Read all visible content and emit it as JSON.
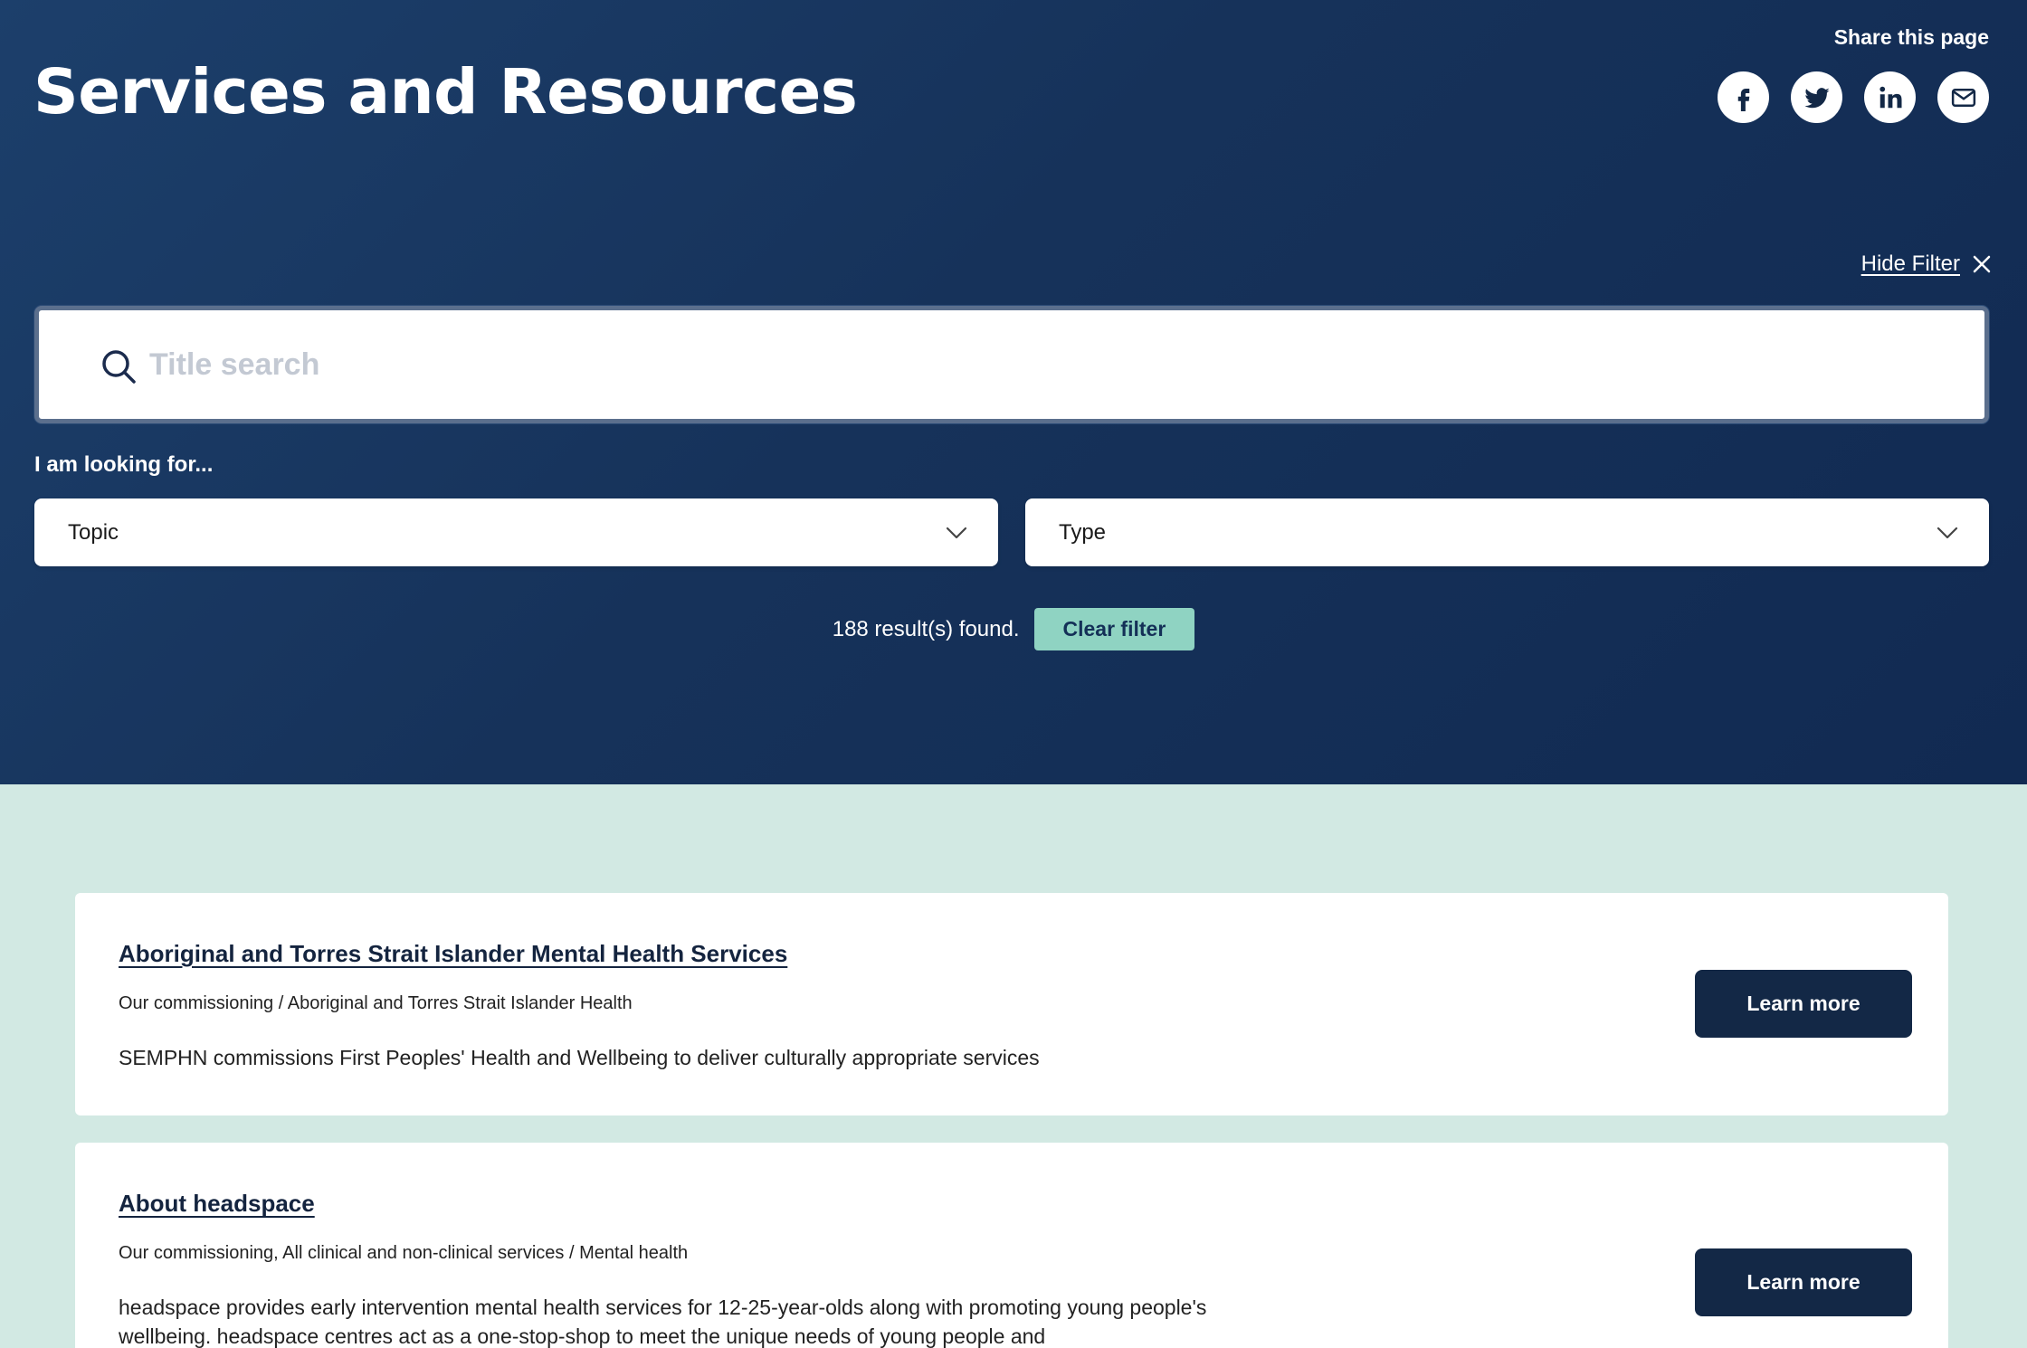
{
  "header": {
    "title": "Services and Resources",
    "share_label": "Share this page",
    "share_icons": [
      "facebook-icon",
      "twitter-icon",
      "linkedin-icon",
      "mail-icon"
    ]
  },
  "filter": {
    "hide_label": "Hide Filter",
    "search_placeholder": "Title search",
    "search_value": "",
    "looking_for_label": "I am looking for...",
    "topic_label": "Topic",
    "type_label": "Type",
    "results_text": "188 result(s) found.",
    "clear_label": "Clear filter"
  },
  "results": [
    {
      "title": "Aboriginal and Torres Strait Islander Mental Health Services",
      "path": "Our commissioning / Aboriginal and Torres Strait Islander Health",
      "description": "SEMPHN commissions First Peoples' Health and Wellbeing to deliver culturally appropriate services",
      "button": "Learn more"
    },
    {
      "title": "About headspace",
      "path": "Our commissioning, All clinical and non-clinical services / Mental health",
      "description": "headspace provides early intervention mental health services for 12-25-year-olds along with promoting young people's wellbeing. headspace centres act as a one-stop-shop to meet the unique needs of young people and",
      "button": "Learn more"
    }
  ],
  "colors": {
    "hero_bg": "#16325a",
    "page_bg": "#d2e9e3",
    "accent": "#8fd3c2",
    "button_dark": "#132846"
  }
}
